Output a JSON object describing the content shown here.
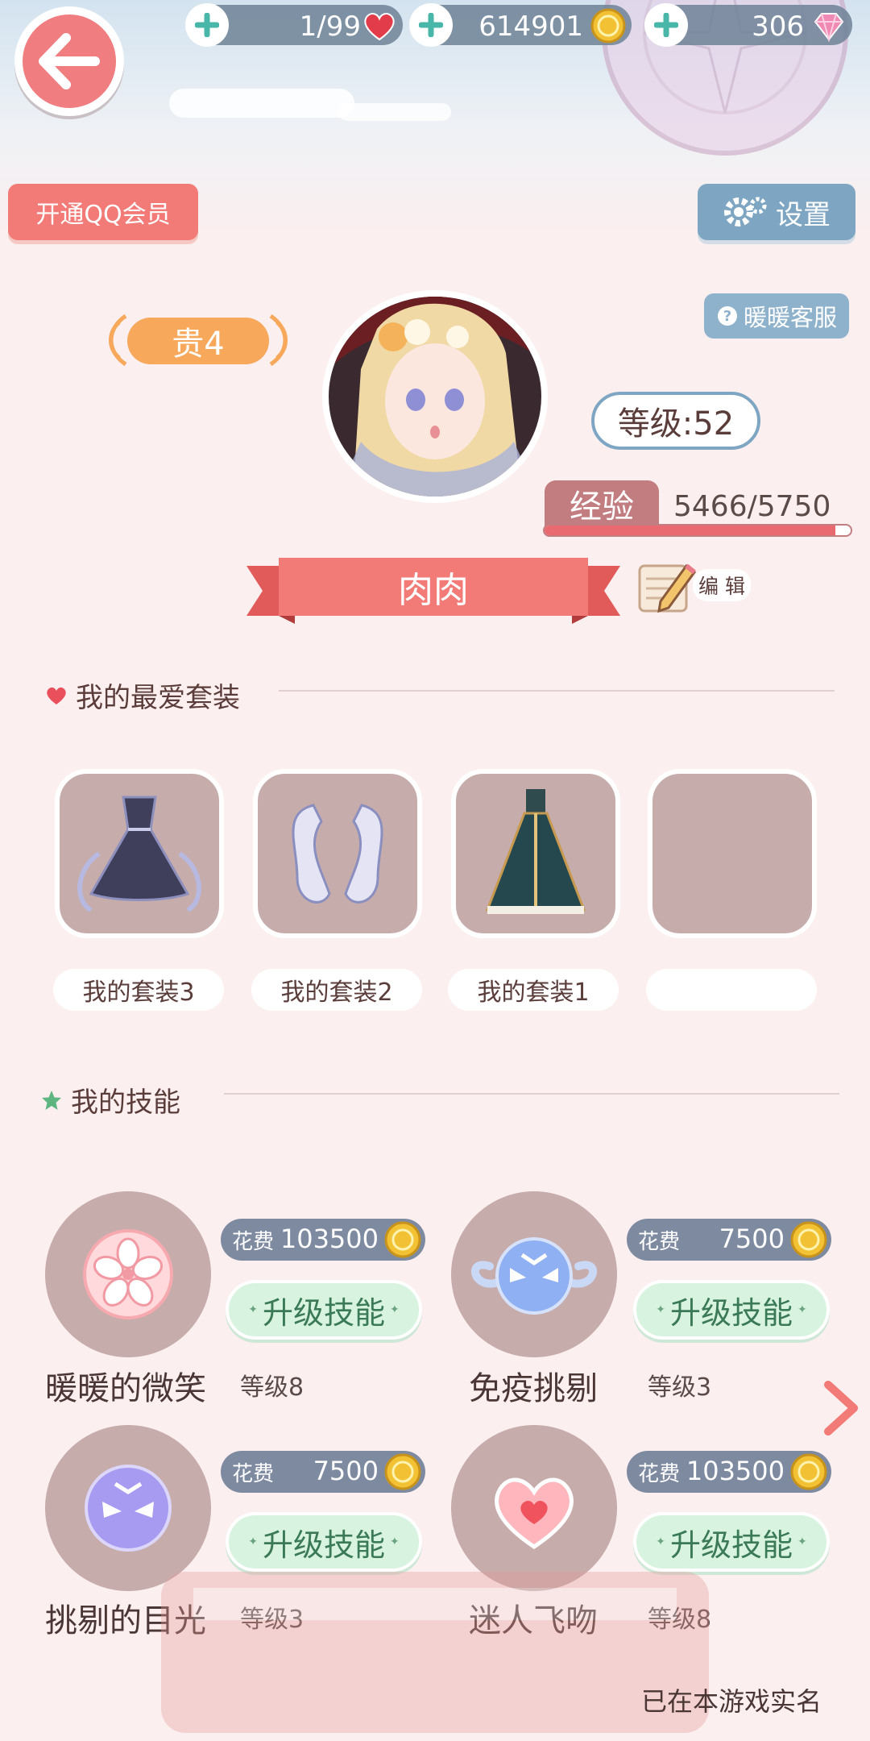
{
  "resources": {
    "hearts": "1/99",
    "coins": "614901",
    "diamonds": "306"
  },
  "buttons": {
    "qq_member": "开通QQ会员",
    "settings": "设置",
    "customer_service": "暖暖客服",
    "edit": "编 辑"
  },
  "profile": {
    "vip": "贵4",
    "level": "等级:52",
    "exp_label": "经验",
    "exp_value": "5466/5750",
    "exp_progress": 0.9506,
    "name": "肉肉"
  },
  "favorites": {
    "title": "我的最爱套装",
    "outfits": [
      {
        "label": "我的套装3",
        "icon": "dark-gown-outfit-icon"
      },
      {
        "label": "我的套装2",
        "icon": "sleeves-outfit-icon"
      },
      {
        "label": "我的套装1",
        "icon": "teal-robe-outfit-icon"
      },
      {
        "label": "",
        "icon": ""
      }
    ]
  },
  "skills": {
    "title": "我的技能",
    "cost_label": "花费",
    "upgrade_label": "升级技能",
    "items": [
      {
        "name": "暖暖的微笑",
        "level": "等级8",
        "cost": "103500",
        "icon": "cherry-blossom-icon"
      },
      {
        "name": "免疫挑剔",
        "level": "等级3",
        "cost": "7500",
        "icon": "winged-mask-icon"
      },
      {
        "name": "挑剔的目光",
        "level": "等级3",
        "cost": "7500",
        "icon": "purple-mask-icon"
      },
      {
        "name": "迷人飞吻",
        "level": "等级8",
        "cost": "103500",
        "icon": "heart-icon"
      }
    ]
  },
  "footer": {
    "realname": "已在本游戏实名"
  },
  "colors": {
    "accent_pink": "#f27b78",
    "accent_blue": "#7ea6c3",
    "vip_orange": "#f7a85a",
    "upgrade_green": "#d8f3e0"
  }
}
